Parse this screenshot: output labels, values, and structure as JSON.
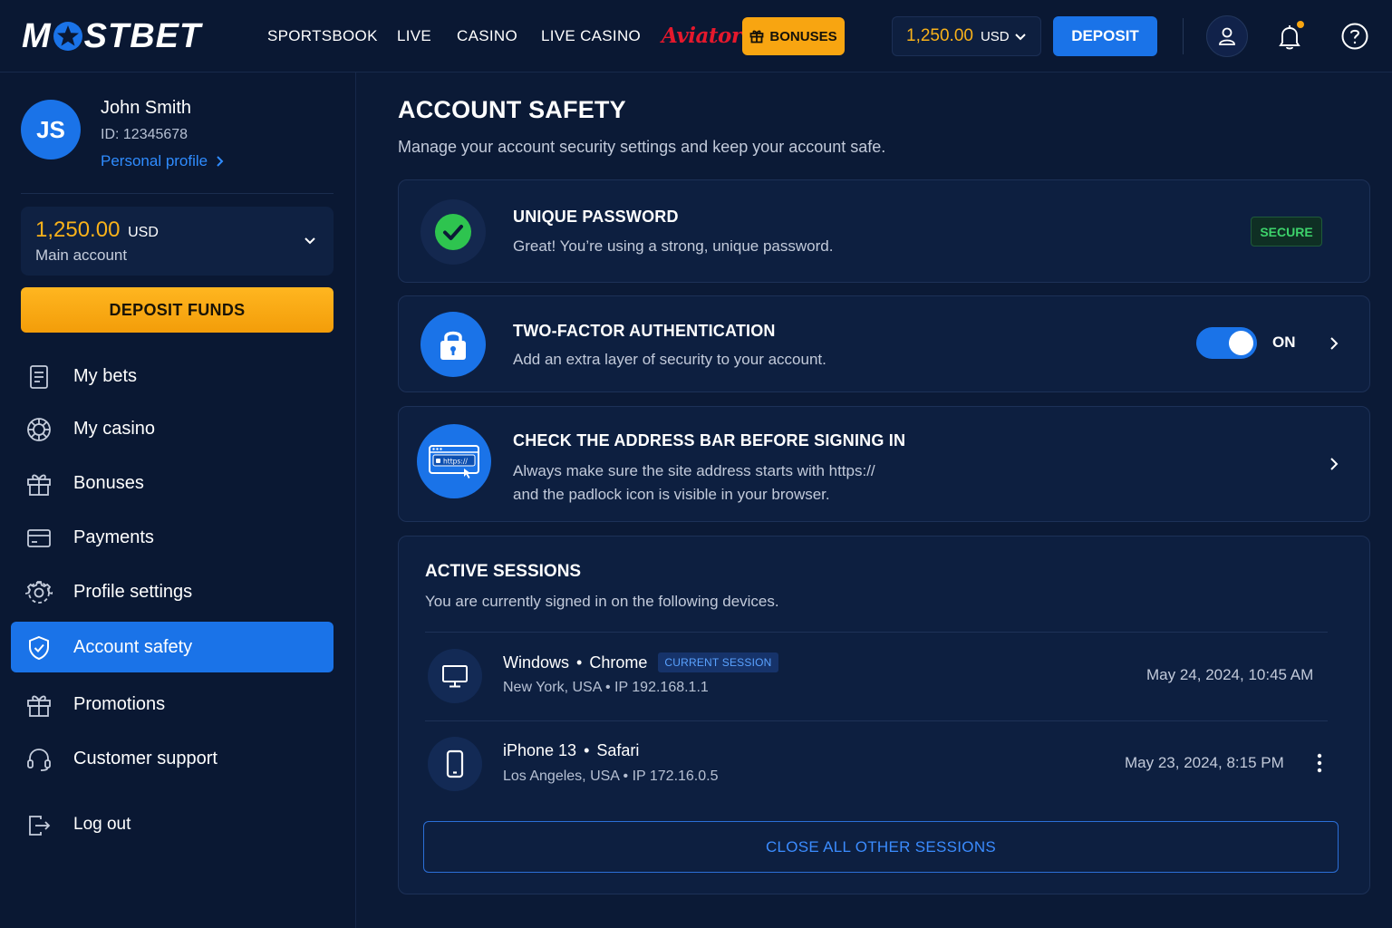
{
  "header": {
    "logo": "MOSTBET",
    "nav": [
      "SPORTSBOOK",
      "LIVE",
      "CASINO",
      "LIVE CASINO"
    ],
    "aviator": "Aviator",
    "bonuses": "BONUSES",
    "balance_amount": "1,250.00",
    "balance_currency": "USD",
    "deposit": "DEPOSIT"
  },
  "sidebar": {
    "avatar_initials": "JS",
    "user_name": "John Smith",
    "user_id": "ID: 12345678",
    "profile_link": "Personal profile",
    "account_amount": "1,250.00",
    "account_currency": "USD",
    "account_label": "Main account",
    "deposit_funds": "DEPOSIT FUNDS",
    "items": [
      {
        "label": "My bets",
        "icon": "receipt-icon"
      },
      {
        "label": "My casino",
        "icon": "casino-chip-icon"
      },
      {
        "label": "Bonuses",
        "icon": "gift-icon"
      },
      {
        "label": "Payments",
        "icon": "wallet-icon"
      },
      {
        "label": "Profile settings",
        "icon": "gear-icon"
      },
      {
        "label": "Account safety",
        "icon": "shield-check-icon",
        "active": true
      },
      {
        "label": "Promotions",
        "icon": "gift-icon"
      },
      {
        "label": "Customer support",
        "icon": "headset-icon"
      },
      {
        "label": "Log out",
        "icon": "logout-icon"
      }
    ]
  },
  "main": {
    "title": "ACCOUNT SAFETY",
    "subtitle": "Manage your account security settings and keep your account safe.",
    "password_card": {
      "title": "UNIQUE PASSWORD",
      "desc": "Great! You’re using a strong, unique password.",
      "badge": "SECURE"
    },
    "twofa_card": {
      "title": "TWO-FACTOR AUTHENTICATION",
      "desc": "Add an extra layer of security to your account.",
      "toggle_label": "ON"
    },
    "address_card": {
      "title": "CHECK THE ADDRESS BAR BEFORE SIGNING IN",
      "desc_line1": "Always make sure the site address starts with https://",
      "desc_line2": "and the padlock icon is visible in your browser.",
      "icon_text": "https://"
    },
    "sessions": {
      "title": "ACTIVE SESSIONS",
      "subtitle": "You are currently signed in on the following devices.",
      "items": [
        {
          "device": "Windows",
          "browser": "Chrome",
          "badge": "CURRENT SESSION",
          "location": "New York, USA",
          "ip": "IP 192.168.1.1",
          "time": "May 24, 2024, 10:45 AM"
        },
        {
          "device": "iPhone 13",
          "browser": "Safari",
          "location": "Los Angeles, USA",
          "ip": "IP 172.16.0.5",
          "time": "May 23, 2024, 8:15 PM"
        }
      ],
      "close_all": "CLOSE ALL OTHER SESSIONS"
    }
  },
  "colors": {
    "background": "#0b1a36",
    "accent_blue": "#1a73e8",
    "accent_orange": "#f8a511",
    "success_green": "#3dd36b",
    "aviator_red": "#e5182c"
  }
}
